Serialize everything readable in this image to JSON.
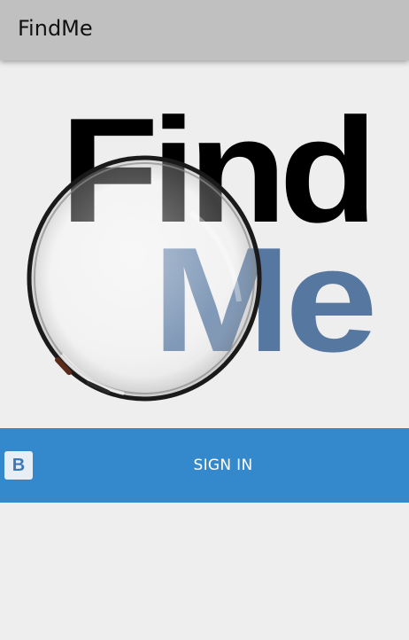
{
  "app_bar": {
    "title": "FindMe"
  },
  "logo": {
    "word_top": "Find",
    "word_bottom": "Me",
    "colors": {
      "find": "#000000",
      "me": "#5677a0"
    }
  },
  "signin": {
    "label": "SIGN IN",
    "icon": "vk-logo-icon",
    "icon_text": "B",
    "color": "#3389cc"
  }
}
